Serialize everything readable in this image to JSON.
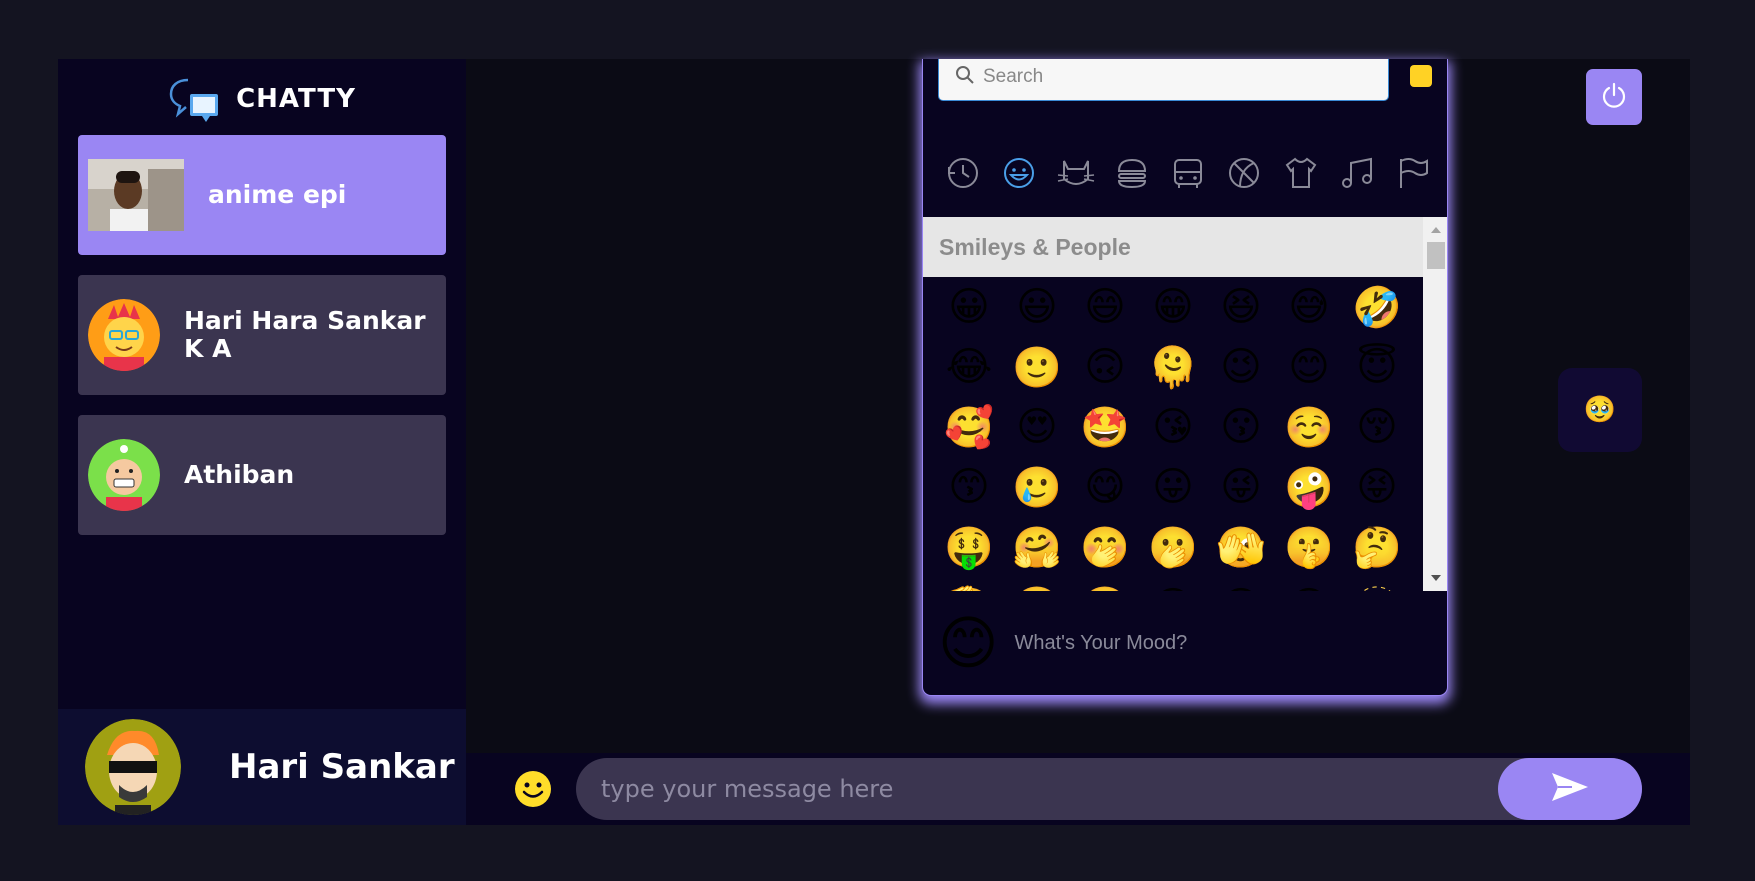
{
  "app": {
    "title": "CHATTY"
  },
  "contacts": [
    {
      "name": "anime epi",
      "selected": true
    },
    {
      "name": "Hari Hara Sankar K A",
      "selected": false
    },
    {
      "name": "Athiban",
      "selected": false
    }
  ],
  "current_user": {
    "name": "Hari Sankar"
  },
  "emoji_picker": {
    "search_placeholder": "Search",
    "categories": [
      "recent-icon",
      "smileys-icon",
      "animals-icon",
      "food-icon",
      "travel-icon",
      "activities-icon",
      "objects-icon",
      "symbols-icon",
      "flags-icon"
    ],
    "active_category": "smileys-icon",
    "section_label": "Smileys & People",
    "emojis": [
      "😀",
      "😃",
      "😄",
      "😁",
      "😆",
      "😅",
      "🤣",
      "😂",
      "🙂",
      "🙃",
      "🫠",
      "😉",
      "😊",
      "😇",
      "🥰",
      "😍",
      "🤩",
      "😘",
      "😗",
      "☺️",
      "😚",
      "😙",
      "🥲",
      "😋",
      "😛",
      "😜",
      "🤪",
      "😝",
      "🤑",
      "🤗",
      "🤭",
      "🫢",
      "🫣",
      "🤫",
      "🤔",
      "🫡",
      "🤐",
      "🤨",
      "😐",
      "😑",
      "😶",
      "🫥"
    ],
    "preview_emoji": "😊",
    "preview_text": "What's Your Mood?",
    "skin_tone_color": "#ffd225"
  },
  "chat": {
    "received_message": "🥹",
    "input_placeholder": "type your message here"
  },
  "colors": {
    "accent": "#9a86f3",
    "sidebar_bg": "#080420",
    "contact_bg": "#3b3550",
    "page_bg": "#141421"
  }
}
